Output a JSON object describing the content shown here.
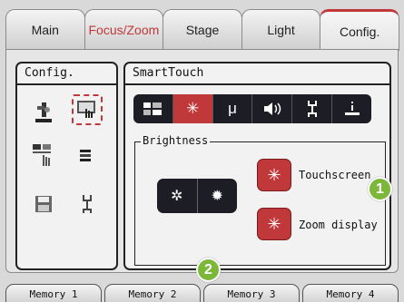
{
  "tabs": [
    {
      "label": "Main"
    },
    {
      "label": "Focus/Zoom"
    },
    {
      "label": "Stage"
    },
    {
      "label": "Light"
    },
    {
      "label": "Config."
    }
  ],
  "config_panel": {
    "title": "Config."
  },
  "smarttouch_panel": {
    "title": "SmartTouch",
    "toolbar": [
      {
        "icon": "settings-grid-icon"
      },
      {
        "icon": "brightness-icon",
        "active": true
      },
      {
        "label": "μ"
      },
      {
        "icon": "speaker-icon"
      },
      {
        "icon": "wrench-icon"
      },
      {
        "icon": "info-icon"
      }
    ],
    "brightness": {
      "label": "Brightness",
      "options": [
        {
          "label": "Touchscreen"
        },
        {
          "label": "Zoom display"
        }
      ]
    }
  },
  "memory_tabs": [
    {
      "label": "Memory 1"
    },
    {
      "label": "Memory 2"
    },
    {
      "label": "Memory 3"
    },
    {
      "label": "Memory 4"
    }
  ],
  "badges": [
    {
      "label": "1"
    },
    {
      "label": "2"
    }
  ],
  "colors": {
    "accent": "#c0383a",
    "badge": "#7bb83a",
    "toolbar": "#1d1d26"
  }
}
